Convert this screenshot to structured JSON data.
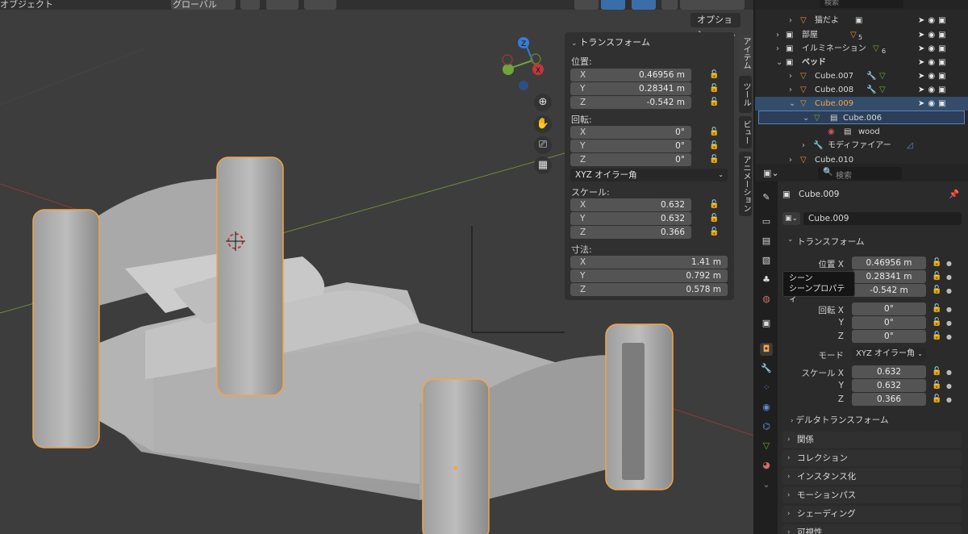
{
  "viewport_header": {
    "mode_label": "オブジェクト",
    "orientation_label": "グローバル",
    "options_label": "オプション"
  },
  "npanel": {
    "title": "トランスフォーム",
    "location_label": "位置:",
    "location": [
      {
        "axis": "X",
        "value": "0.46956 m"
      },
      {
        "axis": "Y",
        "value": "0.28341 m"
      },
      {
        "axis": "Z",
        "value": "-0.542 m"
      }
    ],
    "rotation_label": "回転:",
    "rotation": [
      {
        "axis": "X",
        "value": "0°"
      },
      {
        "axis": "Y",
        "value": "0°"
      },
      {
        "axis": "Z",
        "value": "0°"
      }
    ],
    "rotation_mode": "XYZ オイラー角",
    "scale_label": "スケール:",
    "scale": [
      {
        "axis": "X",
        "value": "0.632"
      },
      {
        "axis": "Y",
        "value": "0.632"
      },
      {
        "axis": "Z",
        "value": "0.366"
      }
    ],
    "dimensions_label": "寸法:",
    "dimensions": [
      {
        "axis": "X",
        "value": "1.41 m"
      },
      {
        "axis": "Y",
        "value": "0.792 m"
      },
      {
        "axis": "Z",
        "value": "0.578 m"
      }
    ]
  },
  "sidebar_tabs": [
    "アイテム",
    "ツール",
    "ビュー",
    "アニメーション"
  ],
  "outliner": {
    "search_placeholder": "検索",
    "rows": [
      {
        "label": "猫だよ"
      },
      {
        "label": "部屋",
        "badge": "5"
      },
      {
        "label": "イルミネーション",
        "badge": "6"
      },
      {
        "label": "ベッド"
      },
      {
        "label": "Cube.007"
      },
      {
        "label": "Cube.008"
      },
      {
        "label": "Cube.009"
      },
      {
        "label": "Cube.006"
      },
      {
        "label": "wood"
      },
      {
        "label": "モディファイアー"
      },
      {
        "label": "Cube.010"
      }
    ]
  },
  "properties": {
    "search_placeholder": "検索",
    "object_name": "Cube.009",
    "object_field": "Cube.009",
    "transform_title": "トランスフォーム",
    "location_label": "位置 X",
    "location_values": [
      "0.46956 m",
      "0.28341 m",
      "-0.542 m"
    ],
    "rotation_label": "回転 X",
    "rotation_values": [
      "0°",
      "0°",
      "0°"
    ],
    "mode_label": "モード",
    "mode_value": "XYZ オイラー角",
    "scale_label": "スケール X",
    "scale_values": [
      "0.632",
      "0.632",
      "0.366"
    ],
    "axis_y": "Y",
    "axis_z": "Z",
    "delta_transform": "デルタトランスフォーム",
    "sections": [
      "関係",
      "コレクション",
      "インスタンス化",
      "モーションパス",
      "シェーディング",
      "可視性"
    ]
  },
  "tooltip": {
    "line1": "シーン",
    "line2": "シーンプロパティ"
  },
  "colors": {
    "selection_orange": "#f5a443",
    "x_axis_red": "#c0393b",
    "y_axis_green": "#6ea639",
    "z_axis_blue": "#3a7bd5",
    "selection_blue": "#334d6b"
  }
}
